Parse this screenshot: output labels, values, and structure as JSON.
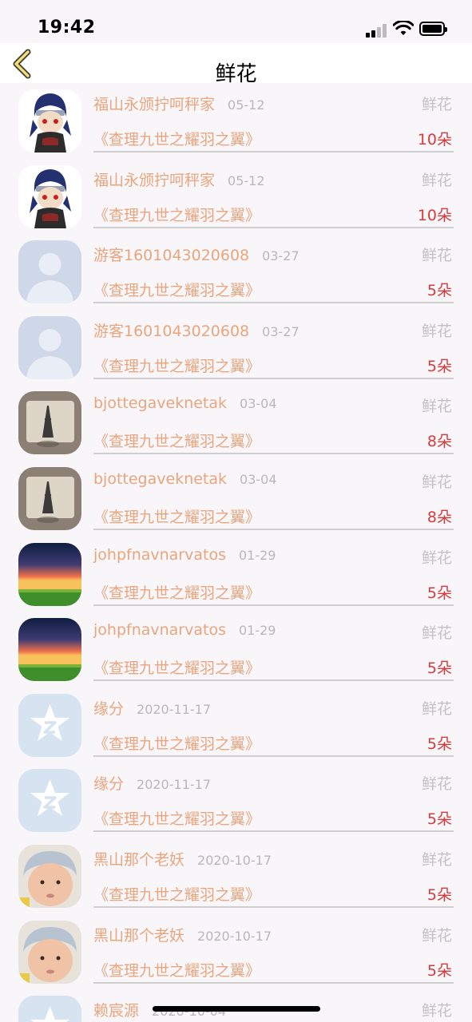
{
  "status_bar": {
    "time": "19:42"
  },
  "nav": {
    "title": "鲜花"
  },
  "records": [
    {
      "name": "福山永颁拧呵秤家",
      "date": "05-12",
      "type": "鲜花",
      "book": "《查理九世之耀羽之翼》",
      "count": "10朵",
      "avatar": "avatar-ninja"
    },
    {
      "name": "福山永颁拧呵秤家",
      "date": "05-12",
      "type": "鲜花",
      "book": "《查理九世之耀羽之翼》",
      "count": "10朵",
      "avatar": "avatar-ninja"
    },
    {
      "name": "游客1601043020608",
      "date": "03-27",
      "type": "鲜花",
      "book": "《查理九世之耀羽之翼》",
      "count": "5朵",
      "avatar": "avatar-default-user"
    },
    {
      "name": "游客1601043020608",
      "date": "03-27",
      "type": "鲜花",
      "book": "《查理九世之耀羽之翼》",
      "count": "5朵",
      "avatar": "avatar-default-user"
    },
    {
      "name": "bjottegaveknetak",
      "date": "03-04",
      "type": "鲜花",
      "book": "《查理九世之耀羽之翼》",
      "count": "8朵",
      "avatar": "avatar-eiffel-tower"
    },
    {
      "name": "bjottegaveknetak",
      "date": "03-04",
      "type": "鲜花",
      "book": "《查理九世之耀羽之翼》",
      "count": "8朵",
      "avatar": "avatar-eiffel-tower"
    },
    {
      "name": "johpfnavnarvatos",
      "date": "01-29",
      "type": "鲜花",
      "book": "《查理九世之耀羽之翼》",
      "count": "5朵",
      "avatar": "avatar-sunset-field"
    },
    {
      "name": "johpfnavnarvatos",
      "date": "01-29",
      "type": "鲜花",
      "book": "《查理九世之耀羽之翼》",
      "count": "5朵",
      "avatar": "avatar-sunset-field"
    },
    {
      "name": "缘分",
      "date": "2020-11-17",
      "type": "鲜花",
      "book": "《查理九世之耀羽之翼》",
      "count": "5朵",
      "avatar": "avatar-qq-star"
    },
    {
      "name": "缘分",
      "date": "2020-11-17",
      "type": "鲜花",
      "book": "《查理九世之耀羽之翼》",
      "count": "5朵",
      "avatar": "avatar-qq-star"
    },
    {
      "name": "黑山那个老妖",
      "date": "2020-10-17",
      "type": "鲜花",
      "book": "《查理九世之耀羽之翼》",
      "count": "5朵",
      "avatar": "avatar-baby"
    },
    {
      "name": "黑山那个老妖",
      "date": "2020-10-17",
      "type": "鲜花",
      "book": "《查理九世之耀羽之翼》",
      "count": "5朵",
      "avatar": "avatar-baby"
    },
    {
      "name": "赖宸源",
      "date": "2020-10-04",
      "type": "鲜花",
      "book": "",
      "count": "",
      "avatar": "avatar-qq-star"
    }
  ],
  "colors": {
    "name_text": "#e8a57e",
    "count_text": "#d23c3c",
    "type_text": "#c2c2c2",
    "back_icon": "#f2dd72"
  }
}
